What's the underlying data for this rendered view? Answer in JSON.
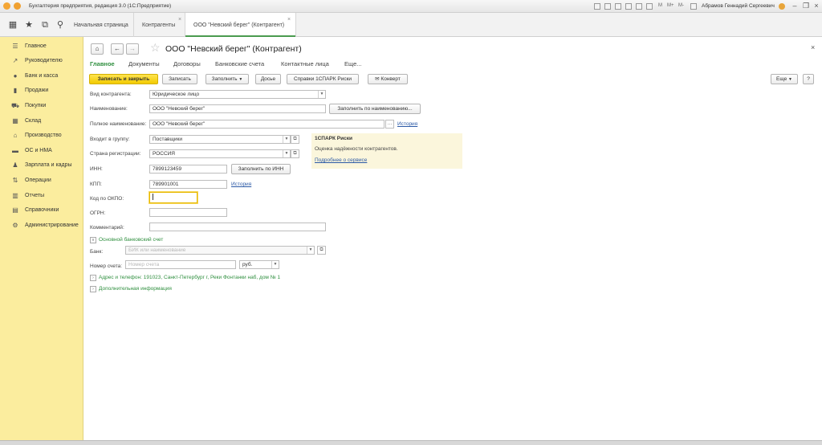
{
  "app": {
    "title": "Бухгалтерия предприятия, редакция 3.0  (1С:Предприятие)",
    "user": "Абрамов Геннадий Сергеевич",
    "m_label": "M",
    "m_plus": "M+",
    "m_minus": "M-"
  },
  "tabs": [
    {
      "label": "Начальная страница"
    },
    {
      "label": "Контрагенты",
      "close": "×"
    },
    {
      "label": "ООО \"Невский берег\" (Контрагент)",
      "close": "×"
    }
  ],
  "sidebar": {
    "items": [
      {
        "label": "Главное",
        "icon": "list-icon"
      },
      {
        "label": "Руководителю",
        "icon": "chart-line-icon"
      },
      {
        "label": "Банк и касса",
        "icon": "coin-icon"
      },
      {
        "label": "Продажи",
        "icon": "bag-icon"
      },
      {
        "label": "Покупки",
        "icon": "cart-icon"
      },
      {
        "label": "Склад",
        "icon": "warehouse-icon"
      },
      {
        "label": "Производство",
        "icon": "factory-icon"
      },
      {
        "label": "ОС и НМА",
        "icon": "truck-icon"
      },
      {
        "label": "Зарплата и кадры",
        "icon": "people-icon"
      },
      {
        "label": "Операции",
        "icon": "operations-icon"
      },
      {
        "label": "Отчеты",
        "icon": "bar-chart-icon"
      },
      {
        "label": "Справочники",
        "icon": "books-icon"
      },
      {
        "label": "Администрирование",
        "icon": "gear-icon"
      }
    ]
  },
  "form": {
    "title": "ООО \"Невский берег\" (Контрагент)",
    "nav": [
      "Главное",
      "Документы",
      "Договоры",
      "Банковские счета",
      "Контактные лица",
      "Еще..."
    ],
    "toolbar": {
      "save_close": "Записать и закрыть",
      "save": "Записать",
      "fill": "Заполнить",
      "dossier": "Досье",
      "spark_ref": "Справки 1СПАРК Риски",
      "envelope": "Конверт",
      "more": "Еще",
      "help": "?"
    },
    "fields": {
      "kind_label": "Вид контрагента:",
      "kind_value": "Юридическое лицо",
      "name_label": "Наименование:",
      "name_value": "ООО \"Невский берег\"",
      "fill_by_name": "Заполнить по наименованию...",
      "fullname_label": "Полное наименование:",
      "fullname_value": "ООО \"Невский берег\"",
      "history": "История",
      "group_label": "Входит в группу:",
      "group_value": "Поставщики",
      "country_label": "Страна регистрации:",
      "country_value": "РОССИЯ",
      "inn_label": "ИНН:",
      "inn_value": "7899123459",
      "fill_by_inn": "Заполнить по ИНН",
      "kpp_label": "КПП:",
      "kpp_value": "789901001",
      "kpp_history": "История",
      "okpo_label": "Код по ОКПО:",
      "ogrn_label": "ОГРН:",
      "comment_label": "Комментарий:"
    },
    "bank": {
      "section": "Основной банковский счет",
      "bank_label": "Банк:",
      "bank_placeholder": "БИК или наименование",
      "account_label": "Номер счета:",
      "account_placeholder": "Номер счета",
      "currency": "руб."
    },
    "address_section": "Адрес и телефон: 191023, Санкт-Петербург г, Реки Фонтанки наб, дом № 1",
    "extra_section": "Дополнительная информация",
    "spark": {
      "title": "1СПАРК Риски",
      "desc": "Оценка надёжности контрагентов.",
      "link": "Подробнее о сервисе"
    }
  }
}
